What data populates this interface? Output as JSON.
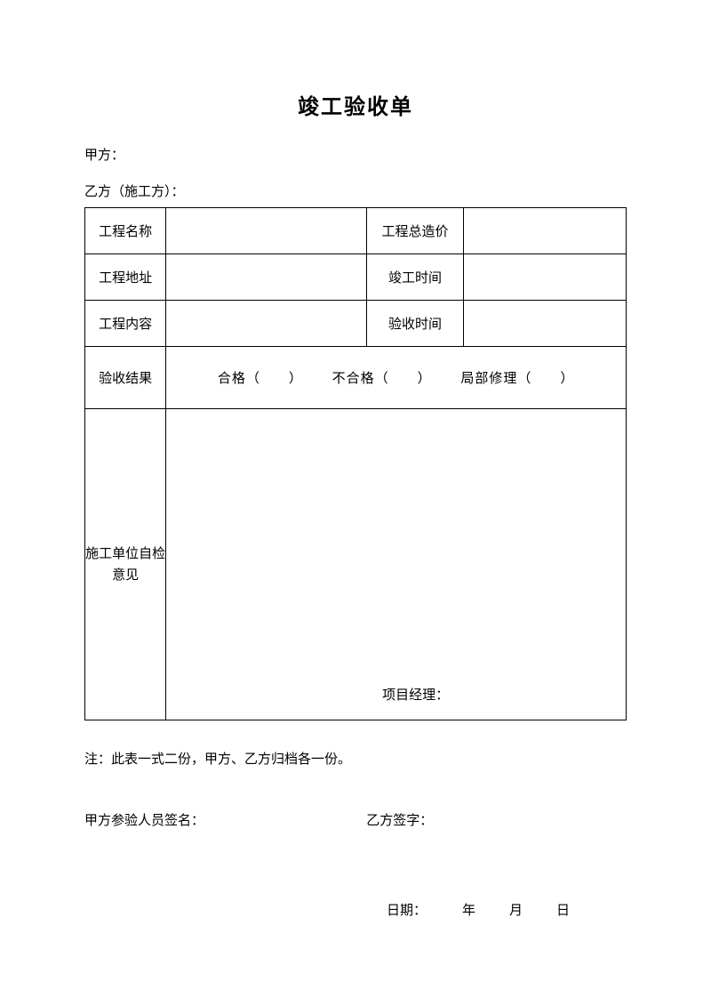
{
  "title": "竣工验收单",
  "partyA": "甲方：",
  "partyB": "乙方（施工方）：",
  "labels": {
    "projectName": "工程名称",
    "totalPrice": "工程总造价",
    "projectAddress": "工程地址",
    "completionTime": "竣工时间",
    "projectContent": "工程内容",
    "acceptanceTime": "验收时间",
    "acceptanceResult": "验收结果",
    "selfCheck": "施工单位自检意见",
    "projectManager": "项目经理："
  },
  "resultOptions": {
    "pass": "合格（　　）",
    "fail": "不合格（　　）",
    "partial": "局部修理（　　）"
  },
  "note": "注：此表一式二份，甲方、乙方归档各一份。",
  "signA": "甲方参验人员签名：",
  "signB": "乙方签字：",
  "date": {
    "prefix": "日期：",
    "year": "年",
    "month": "月",
    "day": "日"
  }
}
